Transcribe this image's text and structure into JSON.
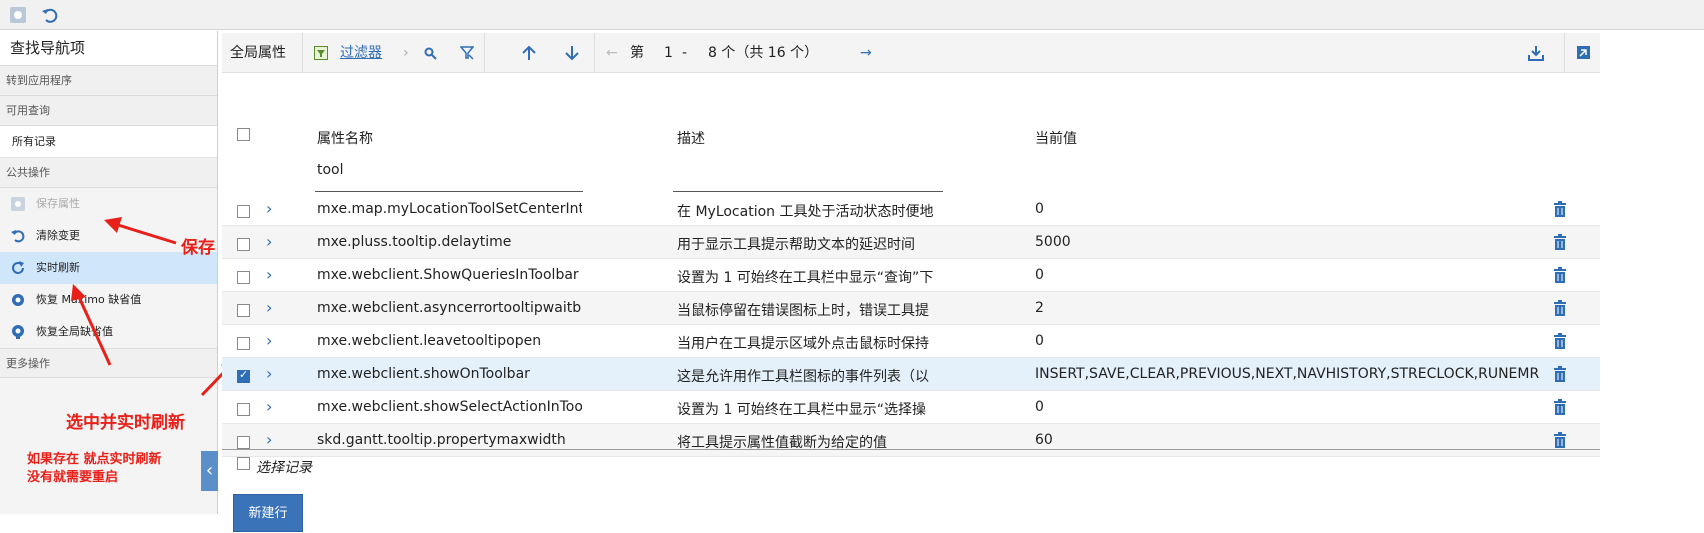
{
  "sidebar": {
    "nav_title": "查找导航项",
    "goto_app": "转到应用程序",
    "available_queries": "可用查询",
    "all_records": "所有记录",
    "public_actions": "公共操作",
    "actions": [
      {
        "label": "保存属性",
        "icon": "save-icon",
        "state": "disabled"
      },
      {
        "label": "清除变更",
        "icon": "undo-icon",
        "state": "normal"
      },
      {
        "label": "实时刷新",
        "icon": "refresh-icon",
        "state": "active"
      },
      {
        "label": "恢复 Maximo 缺省值",
        "icon": "restore-icon",
        "state": "normal"
      },
      {
        "label": "恢复全局缺省值",
        "icon": "restore-global-icon",
        "state": "normal"
      }
    ],
    "more_actions": "更多操作"
  },
  "annotations": {
    "save": "保存",
    "select_refresh": "选中并实时刷新",
    "note_line1": "如果存在 就点实时刷新",
    "note_line2": "没有就需要重启",
    "color": "#e8201a"
  },
  "toolbar": {
    "title": "全局属性",
    "filter_label": "过滤器",
    "page_prefix": "第",
    "page_from": "1",
    "page_dash": "-",
    "page_to": "8 个（共 16 个）"
  },
  "table": {
    "headers": {
      "name": "属性名称",
      "desc": "描述",
      "value": "当前值"
    },
    "filter_name": "tool",
    "rows": [
      {
        "name": "mxe.map.myLocationToolSetCenterInte",
        "desc": "在 MyLocation 工具处于活动状态时便地",
        "value": "0",
        "checked": false
      },
      {
        "name": "mxe.pluss.tooltip.delaytime",
        "desc": "用于显示工具提示帮助文本的延迟时间",
        "value": "5000",
        "checked": false
      },
      {
        "name": "mxe.webclient.ShowQueriesInToolbar",
        "desc": "设置为 1 可始终在工具栏中显示“查询”下",
        "value": "0",
        "checked": false
      },
      {
        "name": "mxe.webclient.asyncerrortooltipwaitbe",
        "desc": "当鼠标停留在错误图标上时，错误工具提",
        "value": "2",
        "checked": false
      },
      {
        "name": "mxe.webclient.leavetooltipopen",
        "desc": "当用户在工具提示区域外点击鼠标时保持",
        "value": "0",
        "checked": false
      },
      {
        "name": "mxe.webclient.showOnToolbar",
        "desc": "这是允许用作工具栏图标的事件列表（以",
        "value": "INSERT,SAVE,CLEAR,PREVIOUS,NEXT,NAVHISTORY,STRECLOCK,RUNEMRG",
        "checked": true
      },
      {
        "name": "mxe.webclient.showSelectActionInTool",
        "desc": "设置为 1 可始终在工具栏中显示“选择操",
        "value": "0",
        "checked": false
      },
      {
        "name": "skd.gantt.tooltip.propertymaxwidth",
        "desc": "将工具提示属性值截断为给定的值",
        "value": "60",
        "checked": false
      }
    ],
    "select_records": "选择记录",
    "new_row": "新建行"
  },
  "colors": {
    "accent": "#2f6db5",
    "selected_row": "#e4f1fb",
    "active_action": "#cfe6fb"
  }
}
